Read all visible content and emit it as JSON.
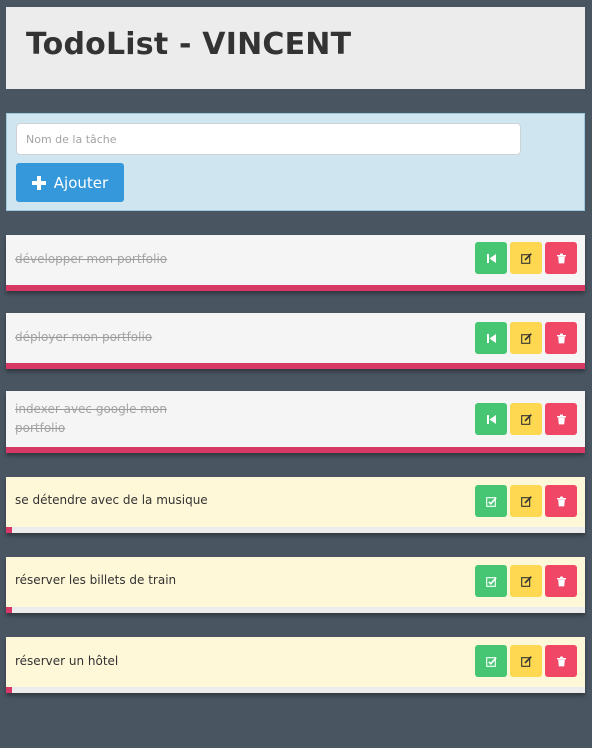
{
  "app": {
    "title": "TodoList - VINCENT"
  },
  "form": {
    "placeholder": "Nom de la tâche",
    "value": "",
    "add_label": "Ajouter"
  },
  "tasks": [
    {
      "label": "développer mon portfolio",
      "done": true
    },
    {
      "label": "déployer mon portfolio",
      "done": true
    },
    {
      "label": "indexer avec google mon portfolio",
      "done": true
    },
    {
      "label": "se détendre avec de la musique",
      "done": false
    },
    {
      "label": "réserver les billets de train",
      "done": false
    },
    {
      "label": "réserver un hôtel",
      "done": false
    }
  ],
  "colors": {
    "background": "#4a5562",
    "header_bg": "#ececec",
    "form_bg": "#cfe5ef",
    "primary_button": "#3498db",
    "done_accent": "#d63a64",
    "todo_bg": "#fef7d8",
    "action_green": "#46c672",
    "action_yellow": "#fdd850",
    "action_red": "#f04766"
  },
  "icons": {
    "add": "plus-icon",
    "undo": "step-backward-icon",
    "complete": "check-square-icon",
    "edit": "edit-icon",
    "delete": "trash-icon"
  }
}
